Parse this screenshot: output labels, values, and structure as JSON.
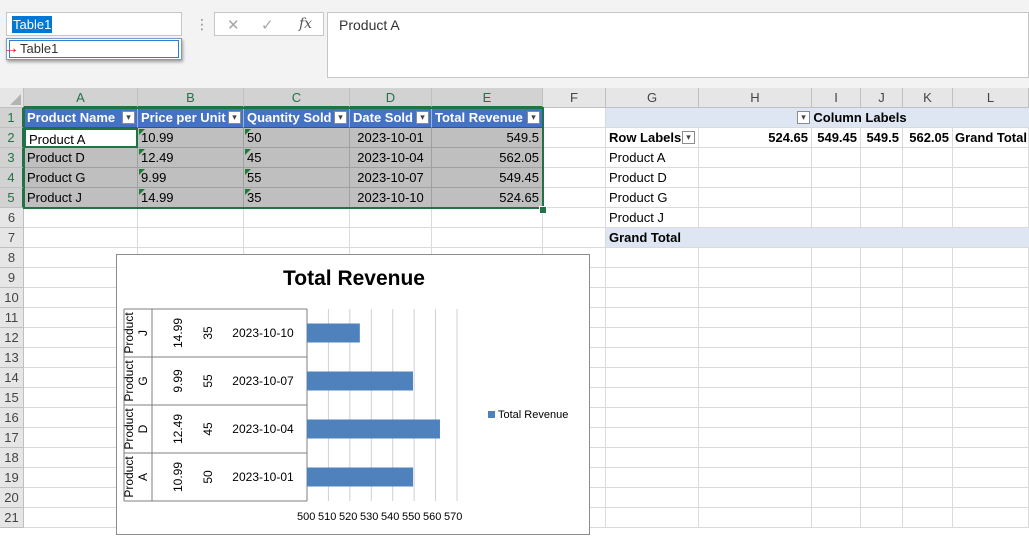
{
  "name_box": {
    "value": "Table1",
    "suggestion": "Table1"
  },
  "formula_bar": {
    "content": "Product A",
    "cancel_icon": "✕",
    "enter_icon": "✓",
    "fx_label": "fx"
  },
  "columns": [
    "A",
    "B",
    "C",
    "D",
    "E",
    "F",
    "G",
    "H",
    "I",
    "J",
    "K",
    "L"
  ],
  "rows": [
    "1",
    "2",
    "3",
    "4",
    "5",
    "6",
    "7",
    "8",
    "9",
    "10",
    "11",
    "12",
    "13",
    "14",
    "15",
    "16",
    "17",
    "18",
    "19",
    "20",
    "21"
  ],
  "table": {
    "headers": [
      "Product Name",
      "Price per Unit",
      "Quantity Sold",
      "Date Sold",
      "Total Revenue"
    ],
    "rows": [
      [
        "Product A",
        "10.99",
        "50",
        "2023-10-01",
        "549.5"
      ],
      [
        "Product D",
        "12.49",
        "45",
        "2023-10-04",
        "562.05"
      ],
      [
        "Product G",
        "9.99",
        "55",
        "2023-10-07",
        "549.45"
      ],
      [
        "Product J",
        "14.99",
        "35",
        "2023-10-10",
        "524.65"
      ]
    ]
  },
  "pivot": {
    "column_labels": "Column Labels",
    "row_labels": "Row Labels",
    "column_values": [
      "524.65",
      "549.45",
      "549.5",
      "562.05"
    ],
    "grand_total": "Grand Total",
    "row_items": [
      "Product A",
      "Product D",
      "Product G",
      "Product J"
    ]
  },
  "chart_data": {
    "type": "bar",
    "title": "Total Revenue",
    "categories": [
      [
        "Product J",
        "14.99",
        "35",
        "2023-10-10"
      ],
      [
        "Product G",
        "9.99",
        "55",
        "2023-10-07"
      ],
      [
        "Product D",
        "12.49",
        "45",
        "2023-10-04"
      ],
      [
        "Product A",
        "10.99",
        "50",
        "2023-10-01"
      ]
    ],
    "series": [
      {
        "name": "Total Revenue",
        "values": [
          524.65,
          549.45,
          562.05,
          549.5
        ],
        "color": "#4f81bd"
      }
    ],
    "xlim": [
      500,
      570
    ],
    "ticks": [
      "500",
      "510",
      "520",
      "530",
      "540",
      "550",
      "560",
      "570"
    ],
    "legend_position": "right",
    "grid": true
  },
  "colors": {
    "table_header": "#4472c4",
    "table_band": "#bfbfbf",
    "accent": "#217346",
    "pivot_header": "#dde6f2"
  }
}
